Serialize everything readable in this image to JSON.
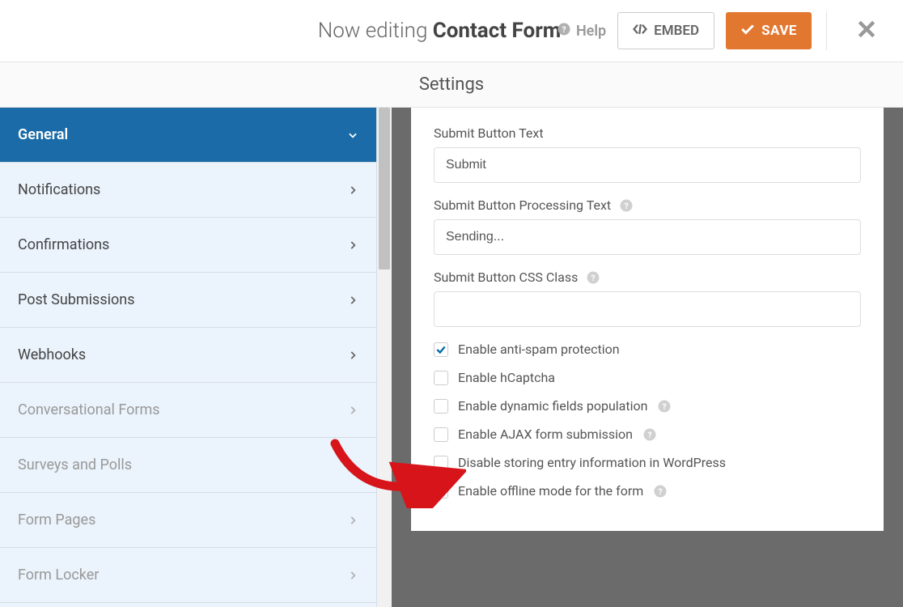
{
  "header": {
    "editing_prefix": "Now editing ",
    "form_name": "Contact Form",
    "help_label": "Help",
    "embed_label": "EMBED",
    "save_label": "SAVE"
  },
  "settings_title": "Settings",
  "sidebar": {
    "items": [
      {
        "label": "General",
        "active": true,
        "disabled": false
      },
      {
        "label": "Notifications",
        "active": false,
        "disabled": false
      },
      {
        "label": "Confirmations",
        "active": false,
        "disabled": false
      },
      {
        "label": "Post Submissions",
        "active": false,
        "disabled": false
      },
      {
        "label": "Webhooks",
        "active": false,
        "disabled": false
      },
      {
        "label": "Conversational Forms",
        "active": false,
        "disabled": true
      },
      {
        "label": "Surveys and Polls",
        "active": false,
        "disabled": true
      },
      {
        "label": "Form Pages",
        "active": false,
        "disabled": true
      },
      {
        "label": "Form Locker",
        "active": false,
        "disabled": true
      }
    ]
  },
  "main": {
    "submit_text_label": "Submit Button Text",
    "submit_text_value": "Submit",
    "processing_label": "Submit Button Processing Text",
    "processing_value": "Sending...",
    "css_class_label": "Submit Button CSS Class",
    "css_class_value": "",
    "checkboxes": [
      {
        "label": "Enable anti-spam protection",
        "checked": true,
        "help": false
      },
      {
        "label": "Enable hCaptcha",
        "checked": false,
        "help": false
      },
      {
        "label": "Enable dynamic fields population",
        "checked": false,
        "help": true
      },
      {
        "label": "Enable AJAX form submission",
        "checked": false,
        "help": true
      },
      {
        "label": "Disable storing entry information in WordPress",
        "checked": false,
        "help": false
      },
      {
        "label": "Enable offline mode for the form",
        "checked": true,
        "help": true
      }
    ]
  },
  "colors": {
    "accent": "#e27730",
    "sidebar_active": "#1a6ba7",
    "check_blue": "#036aab"
  }
}
